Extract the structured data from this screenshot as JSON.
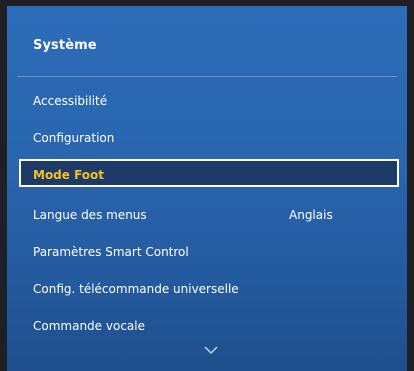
{
  "panel": {
    "title": "Système"
  },
  "menu": {
    "items": [
      {
        "label": "Accessibilité",
        "value": ""
      },
      {
        "label": "Configuration",
        "value": ""
      },
      {
        "label": "Mode Foot",
        "value": ""
      },
      {
        "label": "Langue des menus",
        "value": "Anglais"
      },
      {
        "label": "Paramètres Smart Control",
        "value": ""
      },
      {
        "label": "Config. télécommande universelle",
        "value": ""
      },
      {
        "label": "Commande vocale",
        "value": ""
      }
    ],
    "focused_index": 2
  },
  "icons": {
    "scroll_down": "chevron-down-icon"
  },
  "colors": {
    "panel_blue": "#2a66b0",
    "focus_text": "#f4c21d",
    "focus_bg": "#1d3a68",
    "text": "#ffffff"
  }
}
